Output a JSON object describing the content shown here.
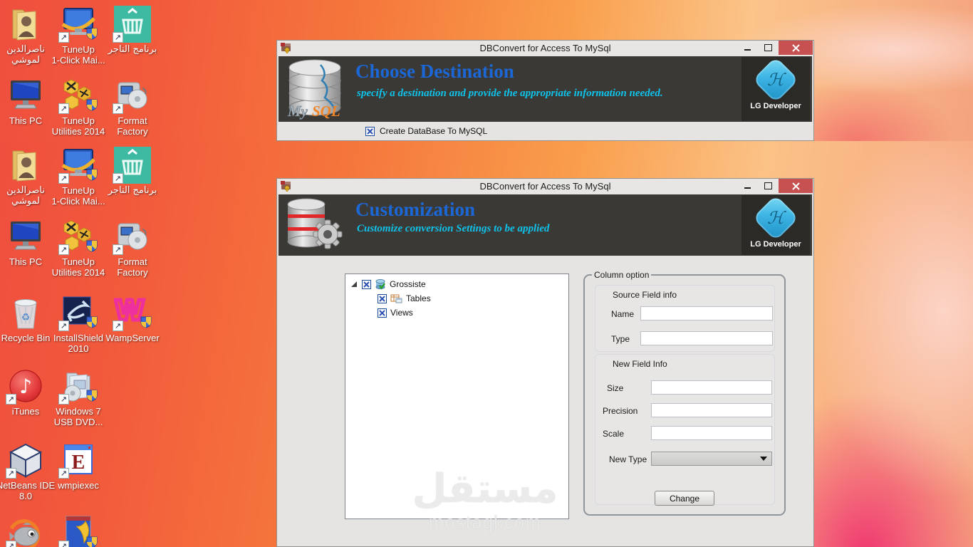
{
  "desktop": {
    "icons": [
      {
        "name": "folder-nasreddine",
        "art": "folderuser",
        "label_lines": [
          "ناصرالدين",
          "لموشي"
        ],
        "col": 0,
        "row": 0,
        "section": 0,
        "shortcut": false
      },
      {
        "name": "tuneup-1click",
        "art": "tuneup1",
        "label_lines": [
          "TuneUp",
          "1-Click Mai..."
        ],
        "col": 1,
        "row": 0,
        "section": 0,
        "shortcut": true
      },
      {
        "name": "merchant-program",
        "art": "basket",
        "label_lines": [
          "برنامج التاجر"
        ],
        "col": 2,
        "row": 0,
        "section": 0,
        "shortcut": true
      },
      {
        "name": "this-pc",
        "art": "thispc",
        "label_lines": [
          "This PC"
        ],
        "col": 0,
        "row": 1,
        "section": 0,
        "shortcut": false
      },
      {
        "name": "tuneup-2014",
        "art": "tuneup2014",
        "label_lines": [
          "TuneUp",
          "Utilities 2014"
        ],
        "col": 1,
        "row": 1,
        "section": 0,
        "shortcut": true
      },
      {
        "name": "format-factory",
        "art": "formatfactory",
        "label_lines": [
          "Format",
          "Factory"
        ],
        "col": 2,
        "row": 1,
        "section": 0,
        "shortcut": true
      },
      {
        "name": "folder-nasreddine",
        "art": "folderuser",
        "label_lines": [
          "ناصرالدين",
          "لموشي"
        ],
        "col": 0,
        "row": 0,
        "section": 1,
        "shortcut": false
      },
      {
        "name": "tuneup-1click",
        "art": "tuneup1",
        "label_lines": [
          "TuneUp",
          "1-Click Mai..."
        ],
        "col": 1,
        "row": 0,
        "section": 1,
        "shortcut": true
      },
      {
        "name": "merchant-program",
        "art": "basket",
        "label_lines": [
          "برنامج التاجر"
        ],
        "col": 2,
        "row": 0,
        "section": 1,
        "shortcut": true
      },
      {
        "name": "this-pc",
        "art": "thispc",
        "label_lines": [
          "This PC"
        ],
        "col": 0,
        "row": 1,
        "section": 1,
        "shortcut": false
      },
      {
        "name": "tuneup-2014",
        "art": "tuneup2014",
        "label_lines": [
          "TuneUp",
          "Utilities 2014"
        ],
        "col": 1,
        "row": 1,
        "section": 1,
        "shortcut": true
      },
      {
        "name": "format-factory",
        "art": "formatfactory",
        "label_lines": [
          "Format",
          "Factory"
        ],
        "col": 2,
        "row": 1,
        "section": 1,
        "shortcut": true
      },
      {
        "name": "recycle-bin",
        "art": "recycle",
        "label_lines": [
          "Recycle Bin"
        ],
        "col": 0,
        "row": 2,
        "section": 1,
        "shortcut": false
      },
      {
        "name": "installshield-2010",
        "art": "installshield",
        "label_lines": [
          "InstallShield",
          "2010"
        ],
        "col": 1,
        "row": 2,
        "section": 1,
        "shortcut": true
      },
      {
        "name": "wampserver",
        "art": "wamp",
        "label_lines": [
          "WampServer"
        ],
        "col": 2,
        "row": 2,
        "section": 1,
        "shortcut": true
      },
      {
        "name": "itunes",
        "art": "itunes",
        "label_lines": [
          "iTunes"
        ],
        "col": 0,
        "row": 3,
        "section": 1,
        "shortcut": true
      },
      {
        "name": "windows7-usb-dvd",
        "art": "win7usb",
        "label_lines": [
          "Windows 7",
          "USB DVD..."
        ],
        "col": 1,
        "row": 3,
        "section": 1,
        "shortcut": true
      },
      {
        "name": "netbeans-ide",
        "art": "netbeans",
        "label_lines": [
          "NetBeans IDE",
          "8.0"
        ],
        "col": 0,
        "row": 4,
        "section": 1,
        "shortcut": true
      },
      {
        "name": "wmpiexec",
        "art": "wmpiexec",
        "label_lines": [
          "wmpiexec"
        ],
        "col": 1,
        "row": 4,
        "section": 1,
        "shortcut": true
      },
      {
        "name": "fish-app",
        "art": "fish",
        "label_lines": [],
        "col": 0,
        "row": 5,
        "section": 1,
        "shortcut": true
      },
      {
        "name": "boomerang-app",
        "art": "boomerang",
        "label_lines": [],
        "col": 1,
        "row": 5,
        "section": 1,
        "shortcut": true
      }
    ]
  },
  "window1": {
    "title": "DBConvert for Access To MySql",
    "header": {
      "title": "Choose Destination",
      "subtitle": "specify a destination and provide the appropriate information needed.",
      "wordmark_my": "My",
      "wordmark_sql": "SQL",
      "logo_monogram": "ℋ",
      "logo_caption": "LG Developer"
    },
    "body": {
      "checkbox_label": "Create DataBase To MySQL",
      "checked": true
    }
  },
  "window2": {
    "title": "DBConvert for Access To MySql",
    "header": {
      "title": "Customization",
      "subtitle": "Customize conversion Settings to be applied",
      "logo_monogram": "ℋ",
      "logo_caption": "LG Developer"
    },
    "tree": {
      "root": {
        "label": "Grossiste",
        "checked": true
      },
      "children": [
        {
          "label": "Tables",
          "checked": true
        },
        {
          "label": "Views",
          "checked": true
        }
      ]
    },
    "column_option": {
      "group_title": "Column option",
      "source_section": {
        "title": "Source Field info",
        "name_label": "Name",
        "name_value": "",
        "type_label": "Type",
        "type_value": ""
      },
      "new_section": {
        "title": "New Field Info",
        "size_label": "Size",
        "size_value": "",
        "precision_label": "Precision",
        "precision_value": "",
        "scale_label": "Scale",
        "scale_value": "",
        "newtype_label": "New Type",
        "newtype_value": ""
      },
      "change_button": "Change"
    }
  },
  "watermark": {
    "arabic": "مستقل",
    "domain": "mostaql.com"
  }
}
